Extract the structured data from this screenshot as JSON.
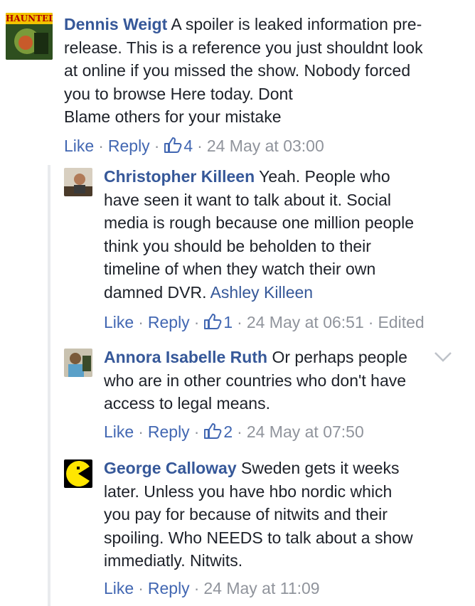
{
  "comments": [
    {
      "author": "Dennis Weigt",
      "text_lines": [
        "A spoiler is leaked information pre-",
        "release. This is a reference you just shouldnt look",
        "at online if you missed the show. Nobody forced",
        "you to browse Here today. Dont",
        "Blame others for your mistake"
      ],
      "avatar_text": "HAUNTED",
      "like_label": "Like",
      "reply_label": "Reply",
      "likes": "4",
      "time": "24 May at 03:00"
    },
    {
      "author": "Christopher Killeen",
      "text_lines": [
        "Yeah. People who",
        "have seen it want to talk about it. Social",
        "media is rough because one million people",
        "think you should be beholden to their",
        "timeline of when they watch their own",
        "damned DVR."
      ],
      "mention": "Ashley Killeen",
      "like_label": "Like",
      "reply_label": "Reply",
      "likes": "1",
      "time": "24 May at 06:51",
      "edited": "Edited"
    },
    {
      "author": "Annora Isabelle Ruth",
      "text_lines": [
        "Or perhaps people",
        "who are in other countries who don't have",
        "access to legal means."
      ],
      "like_label": "Like",
      "reply_label": "Reply",
      "likes": "2",
      "time": "24 May at 07:50"
    },
    {
      "author": "George Calloway",
      "text_lines": [
        "Sweden gets it weeks",
        "later. Unless you have hbo nordic which",
        "you pay for because of nitwits and their",
        "spoiling. Who NEEDS to talk about a show",
        "immediatly. Nitwits."
      ],
      "like_label": "Like",
      "reply_label": "Reply",
      "time": "24 May at 11:09"
    }
  ],
  "colors": {
    "link": "#365899",
    "meta": "#90949c",
    "action": "#4267b2",
    "text": "#1d2129"
  }
}
